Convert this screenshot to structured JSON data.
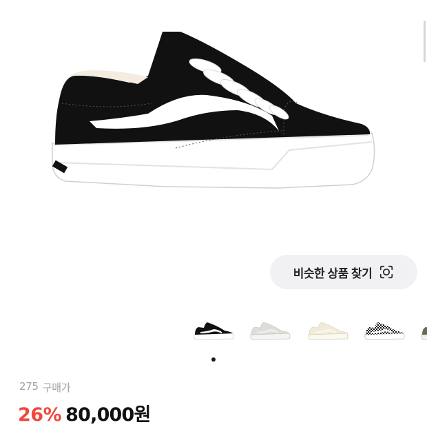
{
  "product": {
    "image_icon": "black-white-low-top-sneaker"
  },
  "similar_button": {
    "label": "비슷한 상품 찾기",
    "icon": "lens-search-icon"
  },
  "thumbnails": [
    {
      "name": "black-white-sneaker"
    },
    {
      "name": "light-grey-sneaker"
    },
    {
      "name": "cream-sneaker"
    },
    {
      "name": "checkerboard-sneaker"
    },
    {
      "name": "olive-sneaker"
    }
  ],
  "carousel": {
    "active_index": 0,
    "dot_color": "#1a1a1a"
  },
  "stats": {
    "count": "275",
    "label": "구매가"
  },
  "price": {
    "discount": "26%",
    "amount": "80,000원"
  },
  "colors": {
    "discount": "#f0483e",
    "button_bg": "#f1f1f3"
  }
}
